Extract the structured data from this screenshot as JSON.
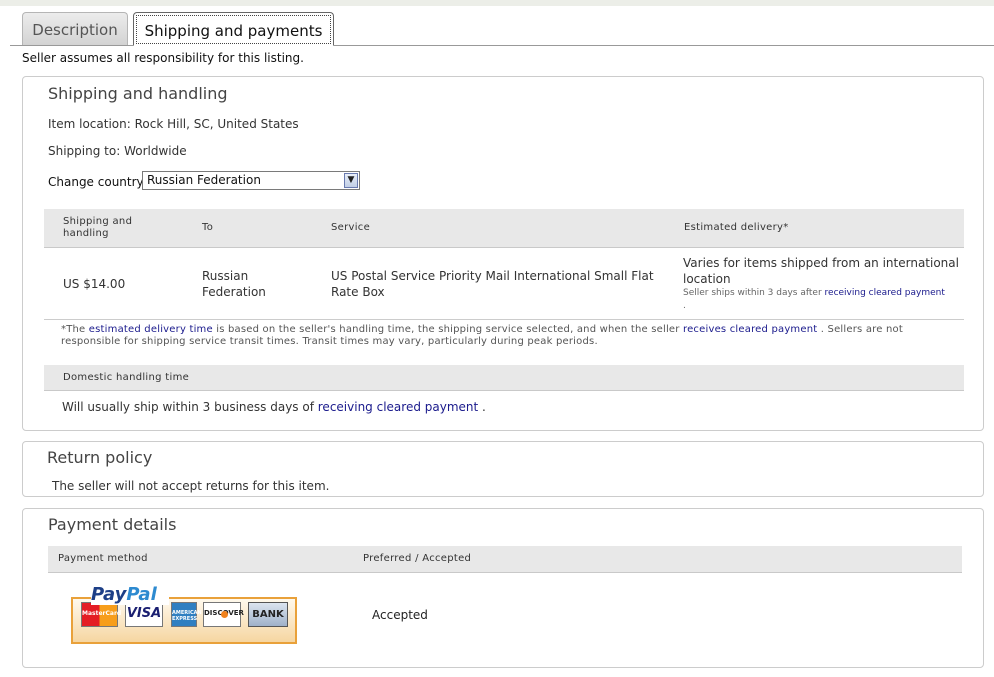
{
  "tabs": [
    {
      "label": "Description"
    },
    {
      "label": "Shipping and payments"
    }
  ],
  "seller_note": "Seller assumes all responsibility for this listing.",
  "shipping": {
    "title": "Shipping and handling",
    "item_location": "Item location: Rock Hill, SC, United States",
    "shipping_to": "Shipping to: Worldwide",
    "change_country_label": "Change country:",
    "country_value": "Russian Federation",
    "columns": [
      "Shipping and handling",
      "To",
      "Service",
      "Estimated delivery*"
    ],
    "row": {
      "cost": "US $14.00",
      "to_line1": "Russian",
      "to_line2": "Federation",
      "service_line1": "US Postal Service Priority Mail International Small Flat",
      "service_line2": "Rate Box",
      "delivery_line1": "Varies for items shipped from an international",
      "delivery_line2": "location",
      "delivery_sub_prefix": "Seller ships within 3 days after",
      "delivery_sub_link": "receiving cleared payment",
      "delivery_sub_suffix": "."
    },
    "note": {
      "p1": "*The ",
      "link1": "estimated delivery time",
      "p2": " is based on the seller's handling time, the shipping service selected, and when the seller ",
      "link2": "receives cleared payment",
      "p3": " . Sellers are not responsible for shipping service transit times. Transit times may vary, particularly during peak periods."
    },
    "domestic_header": "Domestic handling time",
    "domestic_text": "Will usually ship within 3 business days of",
    "domestic_link": "receiving cleared payment",
    "domestic_suffix": " ."
  },
  "returns": {
    "title": "Return policy",
    "text": "The seller will not accept returns for this item."
  },
  "payment": {
    "title": "Payment details",
    "columns": [
      "Payment method",
      "Preferred / Accepted"
    ],
    "logo_pay": "Pay",
    "logo_pal": "Pal",
    "cards": [
      "MasterCard",
      "VISA",
      "AMERICAN EXPRESS",
      "DISCOVER",
      "BANK"
    ],
    "status": "Accepted"
  },
  "colors": {
    "link": "#1a1a8c",
    "header_bg": "#e8e8e8",
    "paypal_dark": "#1d3f87",
    "paypal_light": "#2d8ad0"
  }
}
